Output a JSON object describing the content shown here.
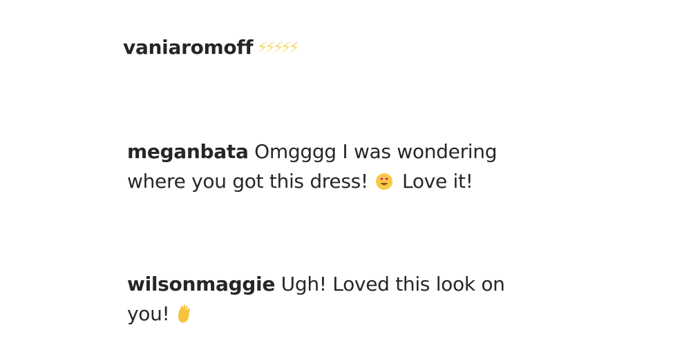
{
  "comments": [
    {
      "username": "vaniaromoff",
      "emoji": "⚡⚡⚡⚡⚡"
    },
    {
      "username": "meganbata",
      "text_line1": "Omgggg I was wondering",
      "text_line2": "where you got this dress!",
      "emoji": "smiling-face-with-heart-eyes-icon",
      "text_after_emoji": "Love it!"
    },
    {
      "username": "wilsonmaggie",
      "text_line1": "Ugh! Loved this look on",
      "text_line2": "you!",
      "emoji": "raised-hand-icon"
    }
  ],
  "colors": {
    "text": "#262626",
    "emoji_yellow": "#f5d75e"
  }
}
